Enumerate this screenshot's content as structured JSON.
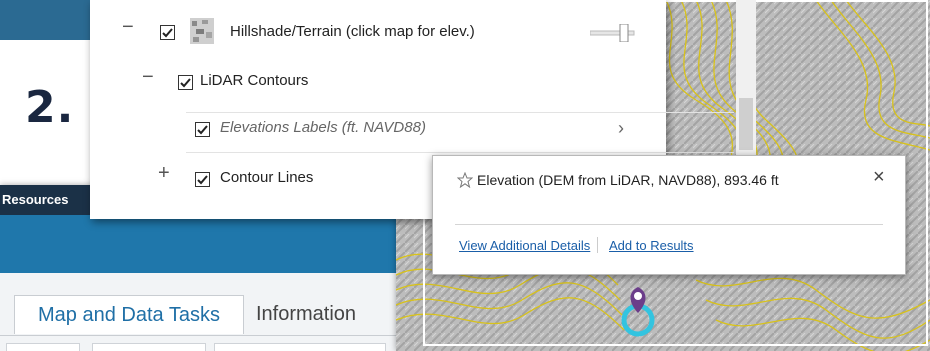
{
  "step": {
    "number": "2."
  },
  "colors": {
    "header_blue": "#2b6a92",
    "contour_yellow": "#d8c21a",
    "link_blue": "#1a5ea8",
    "marker_purple": "#6b3d8a",
    "marker_cyan": "#33c4e0"
  },
  "app": {
    "resources_label": "Resources",
    "tabs": [
      {
        "label": "Map and Data Tasks",
        "active": true
      },
      {
        "label": "Information",
        "active": false
      }
    ]
  },
  "layers": [
    {
      "label": "Hillshade/Terrain (click map for elev.)",
      "expander": "−",
      "checked": true,
      "icon": "raster-layer-icon"
    },
    {
      "label": "LiDAR Contours",
      "expander": "−",
      "checked": true
    },
    {
      "label": "Elevations Labels (ft. NAVD88)",
      "expander": "",
      "checked": true,
      "italic": true
    },
    {
      "label": "Contour Lines",
      "expander": "+",
      "checked": true
    }
  ],
  "popup": {
    "title": "Elevation (DEM from LiDAR, NAVD88), 893.46 ft",
    "close": "×",
    "links": [
      "View Additional Details",
      "Add to Results"
    ]
  }
}
